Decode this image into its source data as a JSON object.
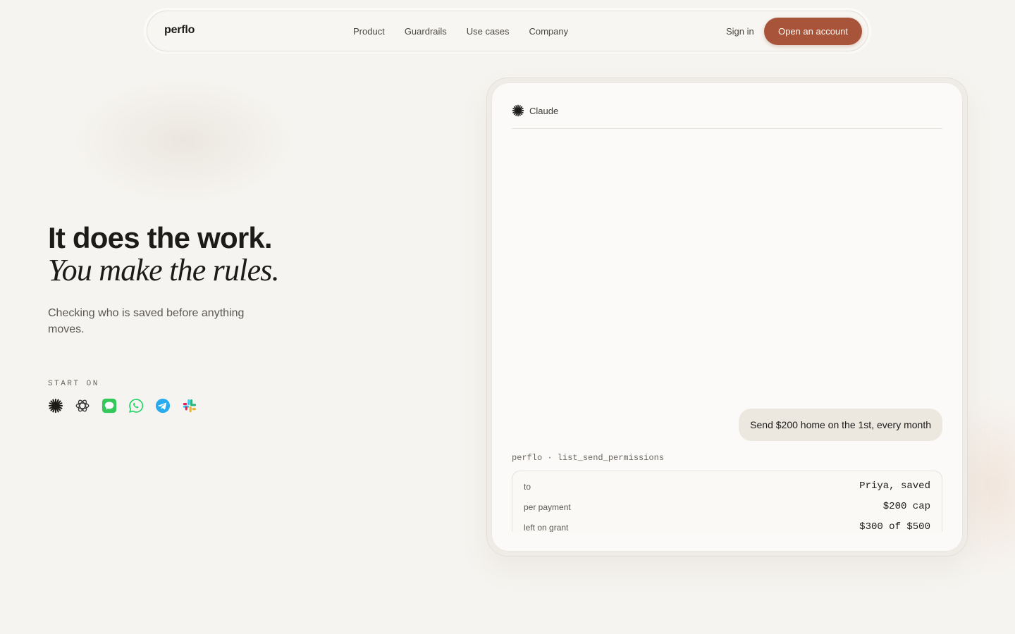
{
  "nav": {
    "logo": "perflo",
    "links": [
      "Product",
      "Guardrails",
      "Use cases",
      "Company"
    ],
    "sign_in": "Sign in",
    "cta": "Open an account"
  },
  "hero": {
    "title": "It does the work.",
    "italic": "You make the rules.",
    "subtitle": "Checking who is saved before anything moves.",
    "start_on_label": "START ON",
    "platforms": [
      {
        "icon": "claude-icon",
        "color": "#1c1b19"
      },
      {
        "icon": "chatgpt-icon",
        "color": "#3a3a3a"
      },
      {
        "icon": "imessage-icon",
        "color": "#34c759"
      },
      {
        "icon": "whatsapp-icon",
        "color": "#25d366"
      },
      {
        "icon": "telegram-icon",
        "color": "#2aabee"
      },
      {
        "icon": "slack-icon",
        "color": "#e01e5a"
      }
    ]
  },
  "chat": {
    "assistant_name": "Claude",
    "user_message": "Send $200 home on the 1st, every month",
    "tool_call": "perflo · list_send_permissions",
    "rows": [
      {
        "label": "to",
        "value": "Priya, saved"
      },
      {
        "label": "per payment",
        "value": "$200 cap"
      },
      {
        "label": "left on grant",
        "value": "$300 of $500"
      }
    ]
  },
  "colors": {
    "background": "#f6f4f0",
    "accent": "#a8543a",
    "bubble": "#ece8df",
    "text": "#1c1b19"
  }
}
